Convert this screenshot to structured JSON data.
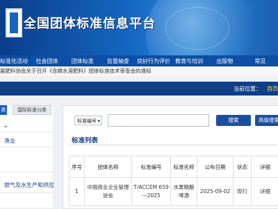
{
  "header": {
    "site_title": "全国团体标准信息平台",
    "logo_icon": "platform-logo-icon"
  },
  "nav": {
    "items": [
      "标准化活动",
      "社会团体",
      "团体标准",
      "监督抽查",
      "良好行为评价",
      "教育与培训",
      "出版物",
      "常见"
    ]
  },
  "notice": {
    "text": "酱肥料协会关于召开《含磷水溶肥料》团体标准技术审查会的通知"
  },
  "location": {
    "label": "当前位置：",
    "value": "首页"
  },
  "left_panel": {
    "tabs": [
      "类",
      "国际标准分类"
    ],
    "categories": [
      "渔业",
      "燃气及水生产和供应"
    ]
  },
  "search": {
    "select_value": "标准编号",
    "input_value": "",
    "search_button": "搜索",
    "advanced_button": "高级搜索"
  },
  "list": {
    "title": "标准列表",
    "columns": [
      "序号",
      "团体名称",
      "标准编号",
      "标准名称",
      "公布日期",
      "状态",
      "详细"
    ],
    "rows": [
      [
        "1",
        "中国商业企业管理协会",
        "T/ACCEM 659—2025",
        "水果精酿啤酒",
        "2025-09-02",
        "现行",
        "详细"
      ]
    ]
  },
  "colors": {
    "nav_bg": "#0d4ea6",
    "accent": "#1a4ea0",
    "location_highlight": "#ffd24d"
  }
}
